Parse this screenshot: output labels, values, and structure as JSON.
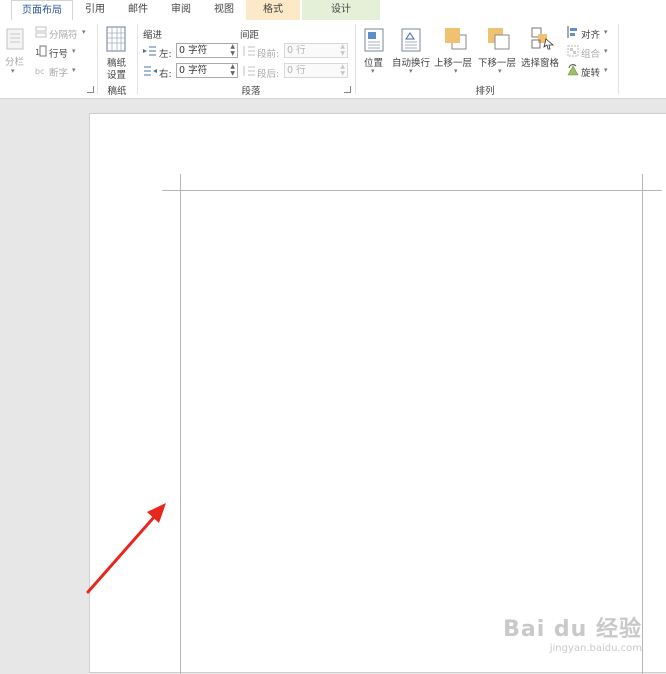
{
  "tabs": [
    {
      "label": "页面布局",
      "active": true
    },
    {
      "label": "引用"
    },
    {
      "label": "邮件"
    },
    {
      "label": "审阅"
    },
    {
      "label": "视图"
    },
    {
      "label": "格式",
      "contextual": true
    },
    {
      "label": "设计",
      "contextual": true
    }
  ],
  "page_setup": {
    "columns_label": "分栏",
    "breaks_label": "分隔符",
    "line_numbers_label": "行号",
    "hyphenation_label": "断字"
  },
  "manuscript": {
    "button_line1": "稿纸",
    "button_line2": "设置",
    "group_label": "稿纸"
  },
  "paragraph": {
    "indent_header": "缩进",
    "spacing_header": "间距",
    "left_label": "左:",
    "left_value": "0 字符",
    "right_label": "右:",
    "right_value": "0 字符",
    "before_label": "段前:",
    "before_value": "0 行",
    "after_label": "段后:",
    "after_value": "0 行",
    "group_label": "段落"
  },
  "arrange": {
    "position_label": "位置",
    "wrap_label": "自动换行",
    "bring_forward_label": "上移一层",
    "send_backward_label": "下移一层",
    "selection_pane_label": "选择窗格",
    "align_label": "对齐",
    "group_label": "组合",
    "rotate_label": "旋转",
    "group_name": "排列"
  },
  "watermark": {
    "line1": "Bai du 经验",
    "line2": "jingyan.baidu.com"
  },
  "colors": {
    "accent": "#2b579a",
    "annotation_arrow": "#e8261c",
    "format_tab": "#fbe9c8",
    "design_tab": "#e4f1d8"
  }
}
